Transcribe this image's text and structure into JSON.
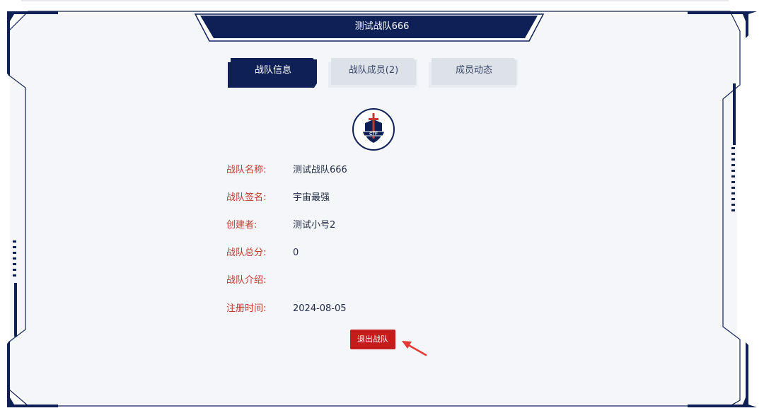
{
  "team_panel": {
    "title": "测试战队666",
    "tabs": [
      {
        "label": "战队信息",
        "active": true
      },
      {
        "label": "战队成员(2)",
        "active": false
      },
      {
        "label": "成员动态",
        "active": false
      }
    ],
    "logo": {
      "icon": "ctf-shield-sword-icon",
      "text": "CTF"
    },
    "fields": [
      {
        "label": "战队名称:",
        "value": "测试战队666"
      },
      {
        "label": "战队签名:",
        "value": "宇宙最强"
      },
      {
        "label": "创建者:",
        "value": "测试小号2"
      },
      {
        "label": "战队总分:",
        "value": "0"
      },
      {
        "label": "战队介绍:",
        "value": ""
      },
      {
        "label": "注册时间:",
        "value": "2024-08-05"
      }
    ],
    "quit_button_label": "退出战队"
  },
  "colors": {
    "navy": "#0f2057",
    "panel_bg": "#f4f6f9",
    "label_red": "#c0392b",
    "button_red": "#c41b1b",
    "inactive_tab": "#dde1e8"
  }
}
